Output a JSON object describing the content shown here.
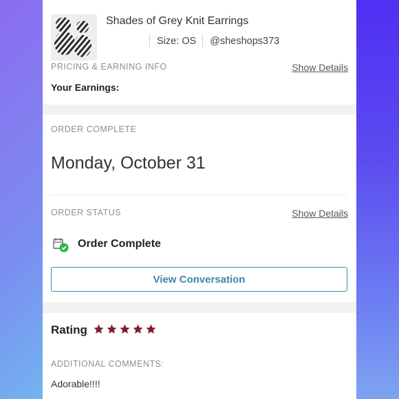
{
  "product": {
    "title": "Shades of Grey Knit Earrings",
    "size": "Size: OS",
    "seller": "@sheshops373"
  },
  "pricing": {
    "header": "PRICING & EARNING INFO",
    "show_details": "Show Details",
    "earnings_label": "Your Earnings:"
  },
  "order": {
    "complete_header": "ORDER COMPLETE",
    "date": "Monday, October 31",
    "status_header": "ORDER STATUS",
    "show_details": "Show Details",
    "status_text": "Order Complete",
    "view_conversation": "View Conversation"
  },
  "rating": {
    "label": "Rating",
    "stars": 5,
    "star_color": "#7a1f2b",
    "comments_header": "ADDITIONAL COMMENTS:",
    "comment": "Adorable!!!!"
  },
  "colors": {
    "accent": "#3a8aa8",
    "success": "#2db34a"
  }
}
